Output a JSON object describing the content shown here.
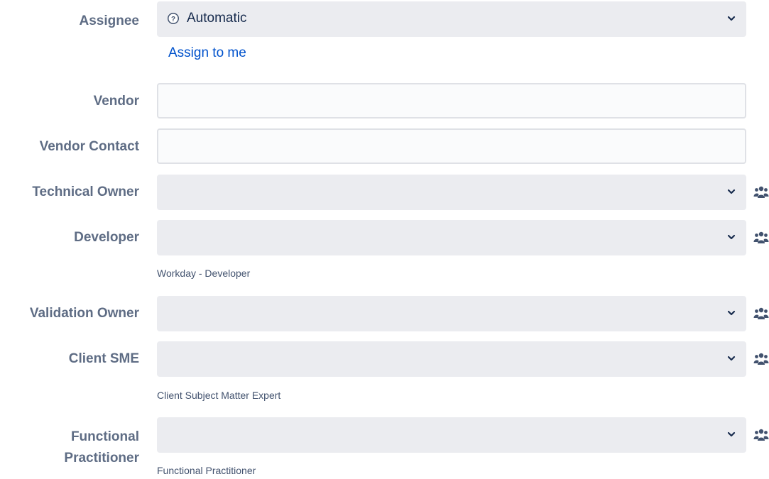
{
  "assignee": {
    "label": "Assignee",
    "value": "Automatic",
    "assign_link": "Assign to me"
  },
  "vendor": {
    "label": "Vendor",
    "value": ""
  },
  "vendor_contact": {
    "label": "Vendor Contact",
    "value": ""
  },
  "technical_owner": {
    "label": "Technical Owner"
  },
  "developer": {
    "label": "Developer",
    "description": "Workday - Developer"
  },
  "validation_owner": {
    "label": "Validation Owner"
  },
  "client_sme": {
    "label": "Client SME",
    "description": "Client Subject Matter Expert"
  },
  "functional_practitioner": {
    "label_line1": "Functional",
    "label_line2": "Practitioner",
    "description": "Functional Practitioner"
  },
  "icons": {
    "help": "help-icon",
    "chevron": "chevron-down-icon",
    "people": "people-group-icon"
  },
  "colors": {
    "label": "#5e6c84",
    "link": "#0052cc",
    "select_bg": "#ebecf0",
    "input_border": "#dfe1e6",
    "icon": "#42526e"
  }
}
